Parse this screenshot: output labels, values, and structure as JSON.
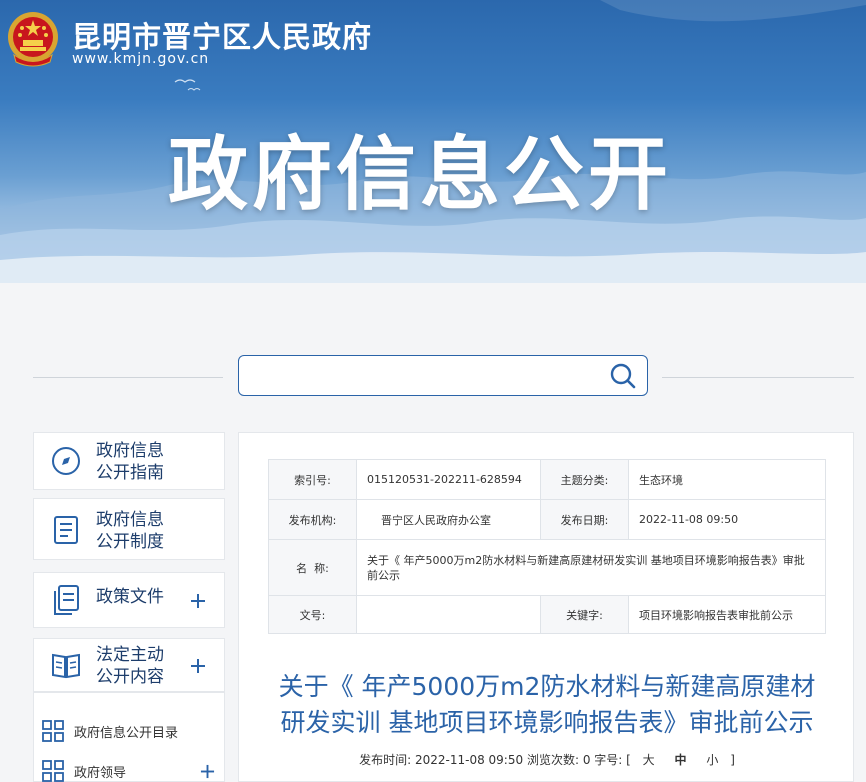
{
  "header": {
    "site_name": "昆明市晋宁区人民政府",
    "site_url": "www.kmjn.gov.cn",
    "banner_title": "政府信息公开"
  },
  "search": {
    "placeholder": "",
    "value": ""
  },
  "sidebar": {
    "items": [
      {
        "label_line1": "政府信息",
        "label_line2": "公开指南",
        "icon": "compass-icon",
        "expandable": false
      },
      {
        "label_line1": "政府信息",
        "label_line2": "公开制度",
        "icon": "document-icon",
        "expandable": false
      },
      {
        "label_line1": "政策文件",
        "label_line2": "",
        "icon": "files-icon",
        "expandable": true
      },
      {
        "label_line1": "法定主动",
        "label_line2": "公开内容",
        "icon": "book-icon",
        "expandable": true
      }
    ],
    "subitems": [
      {
        "label": "政府信息公开目录",
        "expandable": false
      },
      {
        "label": "政府领导",
        "expandable": true
      }
    ]
  },
  "meta_table": {
    "index_no_label": "索引号:",
    "index_no": "015120531-202211-628594",
    "category_label": "主题分类:",
    "category": "生态环境",
    "publisher_label": "发布机构:",
    "publisher": "晋宁区人民政府办公室",
    "pub_date_label": "发布日期:",
    "pub_date": "2022-11-08 09:50",
    "name_label": "名  称:",
    "name": "关于《 年产5000万m2防水材料与新建高原建材研发实训 基地项目环境影响报告表》审批前公示",
    "doc_no_label": "文号:",
    "doc_no": "",
    "keywords_label": "关键字:",
    "keywords": "项目环境影响报告表审批前公示"
  },
  "article": {
    "title_line1": "关于《 年产5000万m2防水材料与新建高原建材",
    "title_line2": "研发实训 基地项目环境影响报告表》审批前公示",
    "pub_time_label": "发布时间:",
    "pub_time": "2022-11-08 09:50",
    "views_label": "浏览次数:",
    "views": "0",
    "font_size_label": "字号:",
    "bracket_open": "[",
    "font_large": "大",
    "font_medium": "中",
    "font_small": "小",
    "bracket_close": "]"
  },
  "colors": {
    "primary": "#2b63a8",
    "nav_text": "#1d3d6b"
  }
}
